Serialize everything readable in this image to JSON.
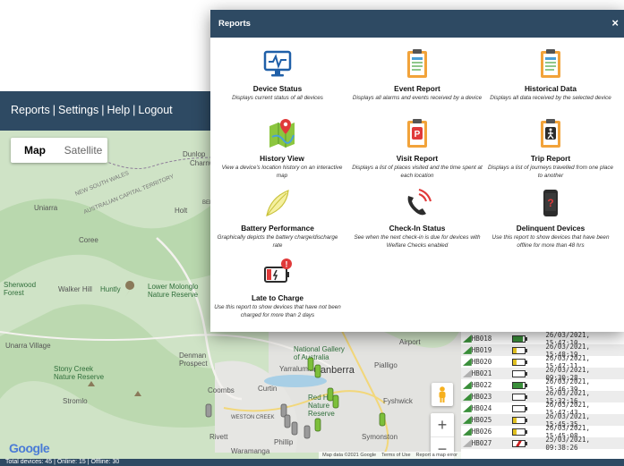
{
  "app": {
    "nav": [
      "Reports",
      "Settings",
      "Help",
      "Logout"
    ],
    "map_type": {
      "map": "Map",
      "satellite": "Satellite"
    },
    "zoom_in": "+",
    "zoom_out": "−",
    "google_logo": "Google",
    "map_footer": [
      "Map data ©2021 Google",
      "Terms of Use",
      "Report a map error"
    ],
    "status_text": "Total devices: 45 | Online: 15 | Offline: 30",
    "map_labels": {
      "unarra": "Uniarra",
      "dunlop": "Dunlop",
      "charnwood": "Charnwood",
      "holt": "Holt",
      "belconnen": "BELCONNEN",
      "coree": "Coree",
      "sherwood_forest": "Sherwood Forest",
      "walker_hill": "Walker Hill",
      "huntly": "Huntly",
      "lower_molonglo": "Lower Molonglo Nature Reserve",
      "unarra_village": "Unarra Village",
      "stony_creek": "Stony Creek Nature Reserve",
      "stromlo": "Stromlo",
      "denman_prospect": "Denman Prospect",
      "coombs": "Coombs",
      "curtin": "Curtin",
      "weston_creek": "WESTON CREEK",
      "rivett": "Rivett",
      "phillip": "Phillip",
      "waramanga": "Waramanga",
      "yarralumla": "Yarralumla",
      "canberra": "Canberra",
      "national_gallery": "National Gallery of Australia",
      "pialligo": "Pialligo",
      "airport": "Airport",
      "red_hill": "Red Hill Nature Reserve",
      "fyshwick": "Fyshwick",
      "symonston": "Symonston",
      "nsw_border": "NEW SOUTH WALES",
      "act_border": "AUSTRALIAN CAPITAL TERRITORY"
    },
    "devices": [
      {
        "id": "HB018",
        "time": "26/03/2021, 15:47:10",
        "battery": 0.8,
        "color": "#3a8f3a"
      },
      {
        "id": "HB019",
        "time": "26/03/2021, 15:48:19",
        "battery": 0.3,
        "color": "#e0c020"
      },
      {
        "id": "HB020",
        "time": "26/03/2021, 15:47:11",
        "battery": 0.3,
        "color": "#e0c020"
      },
      {
        "id": "HB021",
        "time": "26/03/2021, 09:30:28",
        "battery": 0.0,
        "color": "#cccccc"
      },
      {
        "id": "HB022",
        "time": "26/03/2021, 15:46:39",
        "battery": 0.8,
        "color": "#3a8f3a"
      },
      {
        "id": "HB023",
        "time": "26/03/2021, 15:32:16",
        "battery": 0.0,
        "color": "#e0c020"
      },
      {
        "id": "HB024",
        "time": "26/03/2021, 15:47:43",
        "battery": 0.0,
        "color": "#e0c020"
      },
      {
        "id": "HB025",
        "time": "26/03/2021, 15:45:35",
        "battery": 0.3,
        "color": "#e0c020"
      },
      {
        "id": "HB026",
        "time": "26/03/2021, 15:45:08",
        "battery": 0.3,
        "color": "#e0c020"
      },
      {
        "id": "HB027",
        "time": "25/03/2021, 09:38:26",
        "battery": 0.0,
        "color": "#cc2222"
      }
    ]
  },
  "modal": {
    "title": "Reports",
    "close": "×",
    "reports": [
      {
        "title": "Device Status",
        "desc": "Displays current status of all devices",
        "icon": "monitor-pulse-icon"
      },
      {
        "title": "Event Report",
        "desc": "Displays all alarms and events received by a device",
        "icon": "clipboard-list-icon"
      },
      {
        "title": "Historical Data",
        "desc": "Displays all data received by the selected device",
        "icon": "clipboard-list-icon"
      },
      {
        "title": "History View",
        "desc": "View a device's location history on an interactive map",
        "icon": "map-pin-icon"
      },
      {
        "title": "Visit Report",
        "desc": "Displays a list of places visited and the time spent at each location",
        "icon": "clipboard-p-icon"
      },
      {
        "title": "Trip Report",
        "desc": "Displays a list of journeys travelled from one place to another",
        "icon": "clipboard-walk-icon"
      },
      {
        "title": "Battery Performance",
        "desc": "Graphically depicts the battery charge/discharge rate",
        "icon": "leaf-icon"
      },
      {
        "title": "Check-In Status",
        "desc": "See when the next check-in is due for devices with Welfare Checks enabled",
        "icon": "phone-ring-icon"
      },
      {
        "title": "Delinquent Devices",
        "desc": "Use this report to show devices that have been offline for more than 48 hrs",
        "icon": "phone-alert-icon"
      },
      {
        "title": "Late to Charge",
        "desc": "Use this report to show devices that have not been charged for more than 2 days",
        "icon": "battery-alert-icon"
      }
    ]
  }
}
